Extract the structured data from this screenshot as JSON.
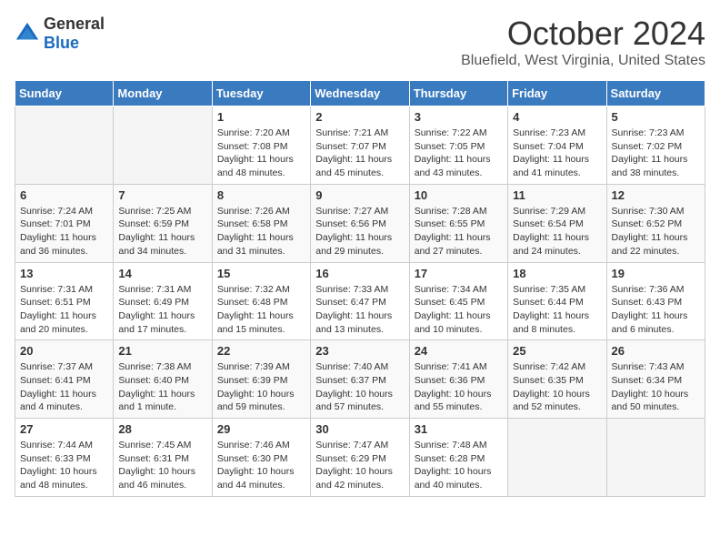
{
  "logo": {
    "general": "General",
    "blue": "Blue"
  },
  "title": "October 2024",
  "location": "Bluefield, West Virginia, United States",
  "days_of_week": [
    "Sunday",
    "Monday",
    "Tuesday",
    "Wednesday",
    "Thursday",
    "Friday",
    "Saturday"
  ],
  "weeks": [
    [
      {
        "day": "",
        "info": ""
      },
      {
        "day": "",
        "info": ""
      },
      {
        "day": "1",
        "info": "Sunrise: 7:20 AM\nSunset: 7:08 PM\nDaylight: 11 hours and 48 minutes."
      },
      {
        "day": "2",
        "info": "Sunrise: 7:21 AM\nSunset: 7:07 PM\nDaylight: 11 hours and 45 minutes."
      },
      {
        "day": "3",
        "info": "Sunrise: 7:22 AM\nSunset: 7:05 PM\nDaylight: 11 hours and 43 minutes."
      },
      {
        "day": "4",
        "info": "Sunrise: 7:23 AM\nSunset: 7:04 PM\nDaylight: 11 hours and 41 minutes."
      },
      {
        "day": "5",
        "info": "Sunrise: 7:23 AM\nSunset: 7:02 PM\nDaylight: 11 hours and 38 minutes."
      }
    ],
    [
      {
        "day": "6",
        "info": "Sunrise: 7:24 AM\nSunset: 7:01 PM\nDaylight: 11 hours and 36 minutes."
      },
      {
        "day": "7",
        "info": "Sunrise: 7:25 AM\nSunset: 6:59 PM\nDaylight: 11 hours and 34 minutes."
      },
      {
        "day": "8",
        "info": "Sunrise: 7:26 AM\nSunset: 6:58 PM\nDaylight: 11 hours and 31 minutes."
      },
      {
        "day": "9",
        "info": "Sunrise: 7:27 AM\nSunset: 6:56 PM\nDaylight: 11 hours and 29 minutes."
      },
      {
        "day": "10",
        "info": "Sunrise: 7:28 AM\nSunset: 6:55 PM\nDaylight: 11 hours and 27 minutes."
      },
      {
        "day": "11",
        "info": "Sunrise: 7:29 AM\nSunset: 6:54 PM\nDaylight: 11 hours and 24 minutes."
      },
      {
        "day": "12",
        "info": "Sunrise: 7:30 AM\nSunset: 6:52 PM\nDaylight: 11 hours and 22 minutes."
      }
    ],
    [
      {
        "day": "13",
        "info": "Sunrise: 7:31 AM\nSunset: 6:51 PM\nDaylight: 11 hours and 20 minutes."
      },
      {
        "day": "14",
        "info": "Sunrise: 7:31 AM\nSunset: 6:49 PM\nDaylight: 11 hours and 17 minutes."
      },
      {
        "day": "15",
        "info": "Sunrise: 7:32 AM\nSunset: 6:48 PM\nDaylight: 11 hours and 15 minutes."
      },
      {
        "day": "16",
        "info": "Sunrise: 7:33 AM\nSunset: 6:47 PM\nDaylight: 11 hours and 13 minutes."
      },
      {
        "day": "17",
        "info": "Sunrise: 7:34 AM\nSunset: 6:45 PM\nDaylight: 11 hours and 10 minutes."
      },
      {
        "day": "18",
        "info": "Sunrise: 7:35 AM\nSunset: 6:44 PM\nDaylight: 11 hours and 8 minutes."
      },
      {
        "day": "19",
        "info": "Sunrise: 7:36 AM\nSunset: 6:43 PM\nDaylight: 11 hours and 6 minutes."
      }
    ],
    [
      {
        "day": "20",
        "info": "Sunrise: 7:37 AM\nSunset: 6:41 PM\nDaylight: 11 hours and 4 minutes."
      },
      {
        "day": "21",
        "info": "Sunrise: 7:38 AM\nSunset: 6:40 PM\nDaylight: 11 hours and 1 minute."
      },
      {
        "day": "22",
        "info": "Sunrise: 7:39 AM\nSunset: 6:39 PM\nDaylight: 10 hours and 59 minutes."
      },
      {
        "day": "23",
        "info": "Sunrise: 7:40 AM\nSunset: 6:37 PM\nDaylight: 10 hours and 57 minutes."
      },
      {
        "day": "24",
        "info": "Sunrise: 7:41 AM\nSunset: 6:36 PM\nDaylight: 10 hours and 55 minutes."
      },
      {
        "day": "25",
        "info": "Sunrise: 7:42 AM\nSunset: 6:35 PM\nDaylight: 10 hours and 52 minutes."
      },
      {
        "day": "26",
        "info": "Sunrise: 7:43 AM\nSunset: 6:34 PM\nDaylight: 10 hours and 50 minutes."
      }
    ],
    [
      {
        "day": "27",
        "info": "Sunrise: 7:44 AM\nSunset: 6:33 PM\nDaylight: 10 hours and 48 minutes."
      },
      {
        "day": "28",
        "info": "Sunrise: 7:45 AM\nSunset: 6:31 PM\nDaylight: 10 hours and 46 minutes."
      },
      {
        "day": "29",
        "info": "Sunrise: 7:46 AM\nSunset: 6:30 PM\nDaylight: 10 hours and 44 minutes."
      },
      {
        "day": "30",
        "info": "Sunrise: 7:47 AM\nSunset: 6:29 PM\nDaylight: 10 hours and 42 minutes."
      },
      {
        "day": "31",
        "info": "Sunrise: 7:48 AM\nSunset: 6:28 PM\nDaylight: 10 hours and 40 minutes."
      },
      {
        "day": "",
        "info": ""
      },
      {
        "day": "",
        "info": ""
      }
    ]
  ]
}
